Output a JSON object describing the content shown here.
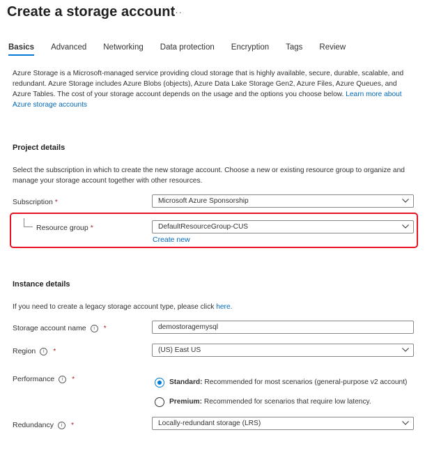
{
  "page": {
    "title": "Create a storage account",
    "more": "···"
  },
  "tabs": [
    {
      "label": "Basics",
      "active": true
    },
    {
      "label": "Advanced"
    },
    {
      "label": "Networking"
    },
    {
      "label": "Data protection"
    },
    {
      "label": "Encryption"
    },
    {
      "label": "Tags"
    },
    {
      "label": "Review"
    }
  ],
  "intro": {
    "text": "Azure Storage is a Microsoft-managed service providing cloud storage that is highly available, secure, durable, scalable, and redundant. Azure Storage includes Azure Blobs (objects), Azure Data Lake Storage Gen2, Azure Files, Azure Queues, and Azure Tables. The cost of your storage account depends on the usage and the options you choose below. ",
    "link": "Learn more about Azure storage accounts"
  },
  "project": {
    "heading": "Project details",
    "description": "Select the subscription in which to create the new storage account. Choose a new or existing resource group to organize and manage your storage account together with other resources.",
    "subscription_label": "Subscription",
    "subscription_value": "Microsoft Azure Sponsorship",
    "resource_group_label": "Resource group",
    "resource_group_value": "DefaultResourceGroup-CUS",
    "create_new": "Create new"
  },
  "instance": {
    "heading": "Instance details",
    "legacy_text": "If you need to create a legacy storage account type, please click ",
    "legacy_link": "here.",
    "name_label": "Storage account name",
    "name_value": "demostoragemysql",
    "region_label": "Region",
    "region_value": "(US) East US",
    "performance_label": "Performance",
    "standard_title": "Standard:",
    "standard_desc": " Recommended for most scenarios (general-purpose v2 account)",
    "premium_title": "Premium:",
    "premium_desc": " Recommended for scenarios that require low latency.",
    "redundancy_label": "Redundancy",
    "redundancy_value": "Locally-redundant storage (LRS)"
  },
  "symbols": {
    "required": "*",
    "info": "i"
  },
  "colors": {
    "accent": "#0078d4",
    "highlight_box": "#e81123",
    "link": "#0067b8",
    "required": "#a4262c"
  }
}
